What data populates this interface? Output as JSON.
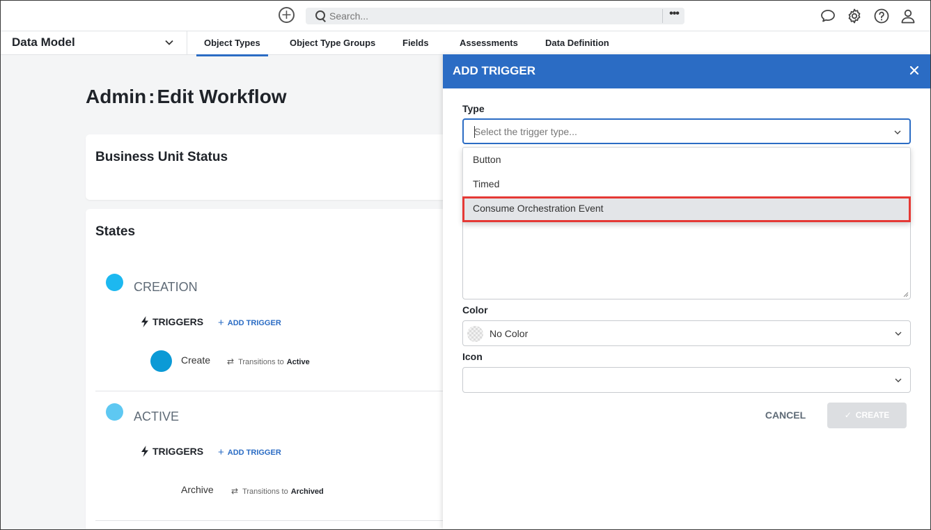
{
  "topbar": {
    "search_placeholder": "Search...",
    "add_icon": "plus-circle-icon",
    "more_icon": "ellipsis-icon",
    "icons": [
      "chat-icon",
      "gear-icon",
      "help-icon",
      "user-icon"
    ]
  },
  "nav": {
    "module": "Data Model",
    "tabs": [
      "Object Types",
      "Object Type Groups",
      "Fields",
      "Assessments",
      "Data Definition"
    ],
    "active_tab": "Object Types"
  },
  "page": {
    "title_part1": "Admin",
    "title_separator": ":",
    "title_part2": "Edit Workflow"
  },
  "workflow": {
    "name": "Business Unit Status",
    "states_title": "States",
    "states": [
      {
        "name": "CREATION",
        "color": "#1cb8f0",
        "triggers_label": "TRIGGERS",
        "add_trigger_label": "ADD TRIGGER",
        "triggers": [
          {
            "name": "Create",
            "transition_label": "Transitions to",
            "target": "Active",
            "color": "#0b9ad6"
          }
        ]
      },
      {
        "name": "ACTIVE",
        "color": "#5ec8f2",
        "triggers_label": "TRIGGERS",
        "add_trigger_label": "ADD TRIGGER",
        "triggers": [
          {
            "name": "Archive",
            "transition_label": "Transitions to",
            "target": "Archived"
          }
        ]
      }
    ]
  },
  "dialog": {
    "title": "ADD TRIGGER",
    "type_label": "Type",
    "type_placeholder": "Select the trigger type...",
    "type_options": [
      "Button",
      "Timed",
      "Consume Orchestration Event"
    ],
    "highlighted_option": "Consume Orchestration Event",
    "color_label": "Color",
    "color_value": "No Color",
    "icon_label": "Icon",
    "cancel_label": "CANCEL",
    "create_label": "CREATE"
  },
  "colors": {
    "accent": "#2b6cc4",
    "highlight_outline": "#e53935"
  }
}
